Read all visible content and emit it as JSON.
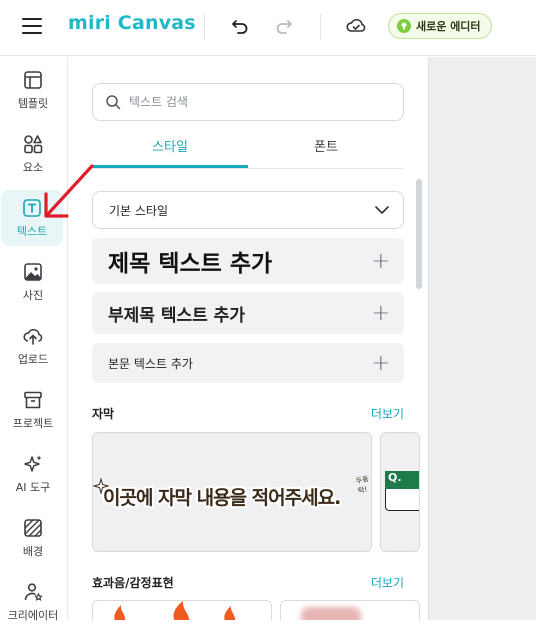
{
  "header": {
    "logo_text": "miri Canvas",
    "new_editor_label": "새로운 에디터",
    "accent_color": "#1fb8c8"
  },
  "sidebar": {
    "items": [
      {
        "label": "템플릿",
        "icon": "template-icon"
      },
      {
        "label": "요소",
        "icon": "elements-icon"
      },
      {
        "label": "텍스트",
        "icon": "text-icon",
        "active": true
      },
      {
        "label": "사진",
        "icon": "photo-icon"
      },
      {
        "label": "업로드",
        "icon": "upload-icon"
      },
      {
        "label": "프로젝트",
        "icon": "project-icon"
      },
      {
        "label": "AI 도구",
        "icon": "ai-tool-icon"
      },
      {
        "label": "배경",
        "icon": "background-icon"
      },
      {
        "label": "크리에이터",
        "icon": "creator-icon"
      }
    ]
  },
  "panel": {
    "search_placeholder": "텍스트 검색",
    "tabs": [
      "스타일",
      "폰트"
    ],
    "active_tab": "스타일",
    "style_dropdown": "기본 스타일",
    "add_heading": "제목 텍스트 추가",
    "add_subheading": "부제목 텍스트 추가",
    "add_body": "본문 텍스트 추가",
    "sections": [
      {
        "title": "자막",
        "more": "더보기"
      },
      {
        "title": "효과음/감정표현",
        "more": "더보기"
      }
    ],
    "subtitle_sample": "이곳에 자막 내용을 적어주세요.",
    "subtitle_small": "두둥탁!",
    "partial_card_text": "Q."
  }
}
